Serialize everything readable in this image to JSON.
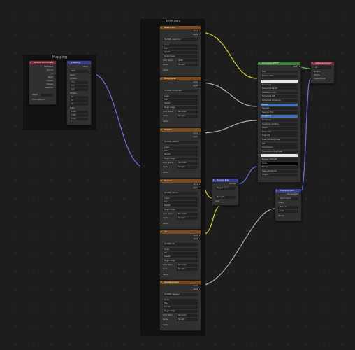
{
  "colors": {
    "vector_wire": "#6b6bd6",
    "color_wire": "#c9c932",
    "float_wire": "#a8a8a8",
    "shader_wire": "#4fc24f",
    "texture_header": "#7a4a1f",
    "mapping_header": "#7d2a3a",
    "vector_header": "#3a3f8f",
    "shader_header": "#3a7a3a"
  },
  "frames": {
    "mapping": "Mapping",
    "textures": "Textures"
  },
  "mapping_frame": {
    "texcoord": {
      "title": "Texture Coordinate",
      "outputs": [
        "Generated",
        "Normal",
        "UV",
        "Object",
        "Camera",
        "Window",
        "Reflection"
      ],
      "object_label": "Object",
      "from_instancer": "From Instancer"
    },
    "mapping": {
      "title": "Mapping",
      "out": "Vector",
      "type": "Point",
      "vector": "Vector",
      "location": "Location",
      "rotation": "Rotation",
      "scale": "Scale",
      "x0": "0 m",
      "y0": "0 m",
      "z0": "0 m",
      "rx": "0°",
      "ry": "0°",
      "rz": "0°",
      "sx": "1.000",
      "sy": "1.000",
      "sz": "1.000"
    }
  },
  "texture_nodes": [
    {
      "title": "Base Color",
      "file": "TextNRJS_BaseColor",
      "cs": "sRGB"
    },
    {
      "title": "Roughness",
      "file": "TextNRJS_Roughness",
      "cs": "Non-Color"
    },
    {
      "title": "Metallic",
      "file": "TextNRJS_Metallic",
      "cs": "Non-Color"
    },
    {
      "title": "Normal",
      "file": "TextNRJS_Normal",
      "cs": "Non-Color"
    },
    {
      "title": "AO",
      "file": "TextNRJS_AO",
      "cs": "Non-Color"
    },
    {
      "title": "Displacement",
      "file": "TextNRJS_Displace",
      "cs": "Non-Color"
    }
  ],
  "tex_rows": {
    "color": "Color",
    "alpha": "Alpha",
    "linear": "Linear",
    "flat": "Flat",
    "repeat": "Repeat",
    "single": "Single Image",
    "colorspace": "Color Space",
    "alpha_mode": "Alpha",
    "straight": "Straight",
    "vector": "Vector"
  },
  "bsdf": {
    "title": "Principled BSDF",
    "out": "BSDF",
    "dist": "GGX",
    "ss": "Random Walk",
    "inputs": [
      "Base Color",
      "Subsurface",
      "Subsurface Radius",
      "Subsurface Color",
      "Subsurface IOR",
      "Subsurface Anisotropy",
      "Metallic",
      "Specular",
      "Specular Tint",
      "Roughness",
      "Anisotropic",
      "Anisotropic Rotation",
      "Sheen",
      "Sheen Tint",
      "Clearcoat",
      "Clearcoat Roughness",
      "IOR",
      "Transmission",
      "Transmission Roughness",
      "Emission",
      "Emission Strength",
      "Alpha",
      "Normal",
      "Clearcoat Normal",
      "Tangent"
    ]
  },
  "output": {
    "title": "Material Output",
    "target": "All",
    "inputs": [
      "Surface",
      "Volume",
      "Displacement"
    ]
  },
  "normalmap": {
    "title": "Normal Map",
    "out": "Normal",
    "space": "Tangent Space",
    "strength": "Strength",
    "color": "Color"
  },
  "displacement": {
    "title": "Displacement",
    "out": "Displacement",
    "space": "Object Space",
    "height": "Height",
    "midlevel": "Midlevel",
    "scale": "Scale",
    "normal": "Normal",
    "mid_v": "0.500",
    "scale_v": "0.100"
  }
}
